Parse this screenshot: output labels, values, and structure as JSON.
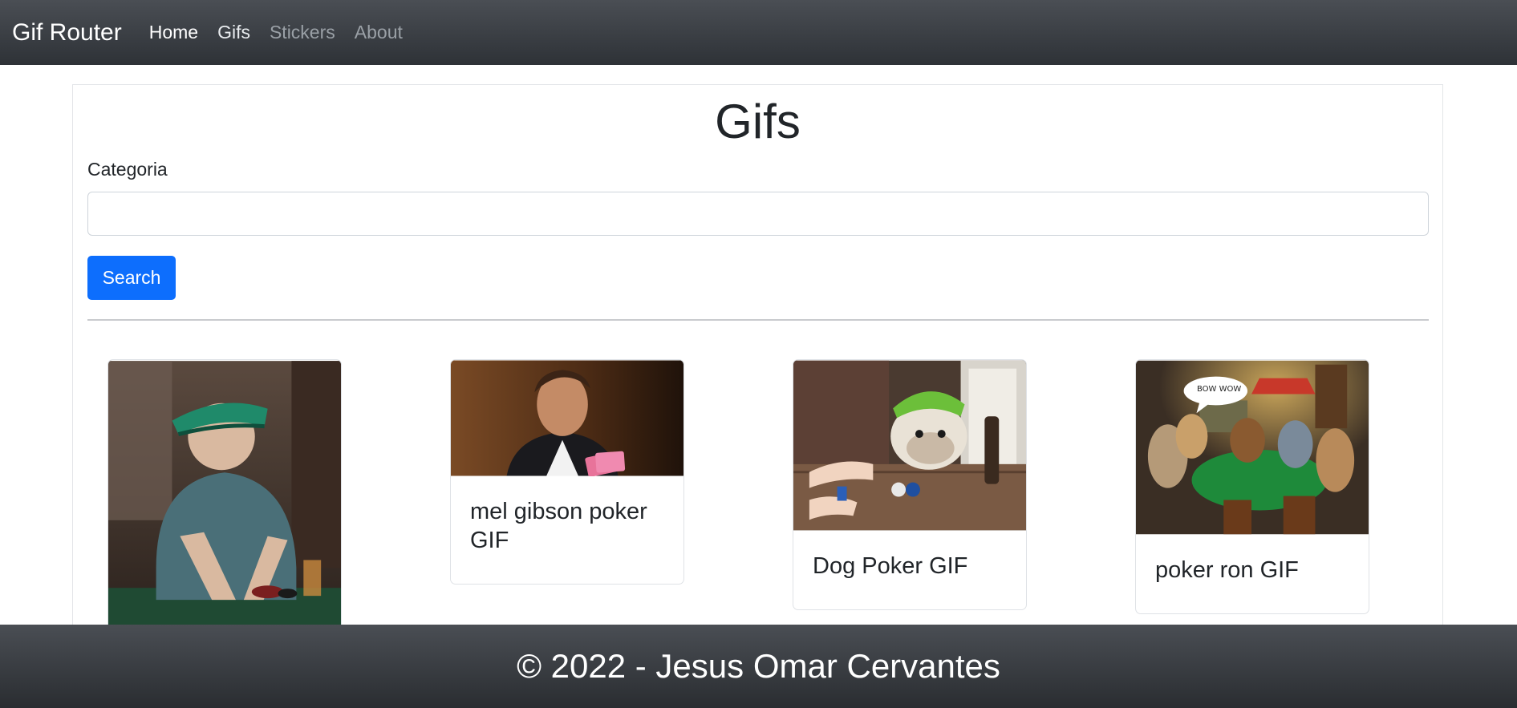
{
  "navbar": {
    "brand": "Gif Router",
    "links": [
      {
        "label": "Home",
        "state": "active"
      },
      {
        "label": "Gifs",
        "state": "normal"
      },
      {
        "label": "Stickers",
        "state": "muted"
      },
      {
        "label": "About",
        "state": "muted"
      }
    ]
  },
  "main": {
    "title": "Gifs",
    "input_label": "Categoria",
    "input_value": "",
    "input_placeholder": "",
    "search_label": "Search"
  },
  "cards": [
    {
      "title": "",
      "image": "old man pushing poker chips"
    },
    {
      "title": "mel gibson poker GIF",
      "image": "man in suit holding cards"
    },
    {
      "title": "Dog Poker GIF",
      "image": "bulldog wearing green visor at table"
    },
    {
      "title": "poker ron GIF",
      "image": "dogs playing poker painting",
      "speech_bubble": "BOW WOW"
    }
  ],
  "footer": {
    "text": "© 2022 - Jesus Omar Cervantes"
  },
  "colors": {
    "navbar": "#343a40",
    "primary": "#0d6efd",
    "footer": "#343a40"
  }
}
